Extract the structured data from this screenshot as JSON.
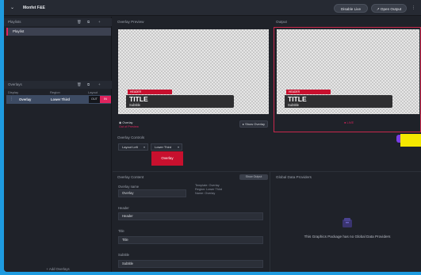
{
  "app": {
    "title": "Monfet F&E",
    "buttons": {
      "disable_live": "Disable Live",
      "open_output": "Open Output"
    }
  },
  "sidebar": {
    "playlists_label": "Playlists",
    "playlist_item": "Playlist",
    "overlays_label": "Overlays",
    "columns": {
      "display": "Display",
      "region": "Region",
      "layout": "Layout"
    },
    "overlay_row": {
      "name": "Overlay",
      "region": "Lower Third",
      "out": "OUT",
      "in": "IN"
    },
    "add_overlays": "+ Add Overlays"
  },
  "preview": {
    "title": "Overlay Preview",
    "overlay_name": "Overlay",
    "overlay_state": "Out of Preview",
    "show_button": "Show Overlay",
    "lower_third": {
      "tag": "HEADER",
      "title": "TITLE",
      "subtitle": "Subtitle"
    }
  },
  "output": {
    "title": "Output",
    "lower_third": {
      "tag": "HEADER",
      "title": "TITLE",
      "subtitle": "Subtitle"
    },
    "status": "LIVE"
  },
  "controls": {
    "title": "Overlay Controls",
    "layout_select": "Layout Left",
    "region_select": "Lower Third",
    "overlay_button": "Overlay"
  },
  "content": {
    "title": "Overlay Content",
    "show_output": "Show Output",
    "overlay_name_label": "Overlay name",
    "overlay_name_value": "Overlay",
    "note": "Template: Overlay\nRegion: Lower Third\nName: Overlay",
    "header_label": "Header",
    "header_value": "Header",
    "title_label": "Title",
    "title_value": "Title",
    "subtitle_label": "Subtitle",
    "subtitle_value": "Subtitle"
  },
  "global_data": {
    "title": "Global Data Providers",
    "empty_text": "This Graphics Package has no Global Data Providers"
  },
  "colors": {
    "accent": "#e0245e",
    "brand_red": "#c8102e",
    "background": "#1f2229",
    "frame": "#1e9be0"
  }
}
